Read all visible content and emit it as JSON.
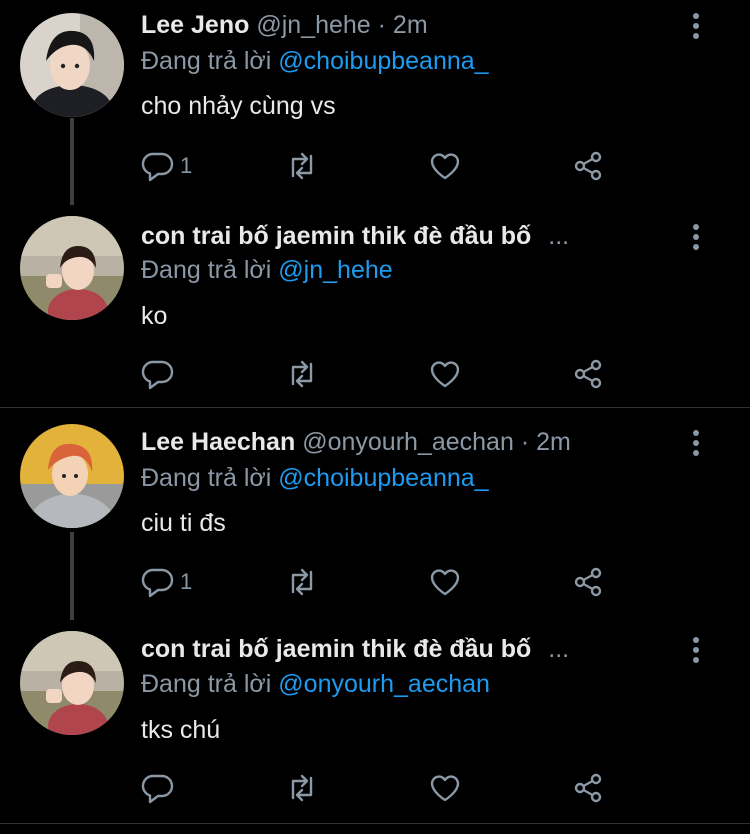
{
  "replying_label": "Đang trả lời",
  "tweets": [
    {
      "name": "Lee Jeno",
      "handle": "@jn_hehe",
      "time": "· 2m",
      "reply_to": "@choibupbeanna_",
      "text": "cho nhảy cùng vs",
      "reply_count": "1",
      "avatar": "Lee Jeno profile photo"
    },
    {
      "name": "con trai bố jaemin thik đè đầu bố",
      "ellipsis": "...",
      "reply_to": "@jn_hehe",
      "text": "ko",
      "reply_count": "",
      "avatar": "child profile photo"
    },
    {
      "name": "Lee Haechan",
      "handle": "@onyourh_aechan",
      "time": "· 2m",
      "reply_to": "@choibupbeanna_",
      "text": "ciu ti đs",
      "reply_count": "1",
      "avatar": "Lee Haechan profile photo"
    },
    {
      "name": "con trai bố jaemin thik đè đầu bố",
      "ellipsis": "...",
      "reply_to": "@onyourh_aechan",
      "text": "tks chú",
      "reply_count": "",
      "avatar": "child profile photo"
    }
  ],
  "icons": {
    "reply": "comment-icon",
    "retweet": "retweet-icon",
    "like": "heart-icon",
    "share": "share-icon",
    "more": "more-vertical-icon"
  },
  "colors": {
    "background": "#000000",
    "name": "#e7e9ea",
    "secondary": "#8b98a5",
    "mention": "#1d9bf0",
    "thread_line": "#3a3f44"
  }
}
